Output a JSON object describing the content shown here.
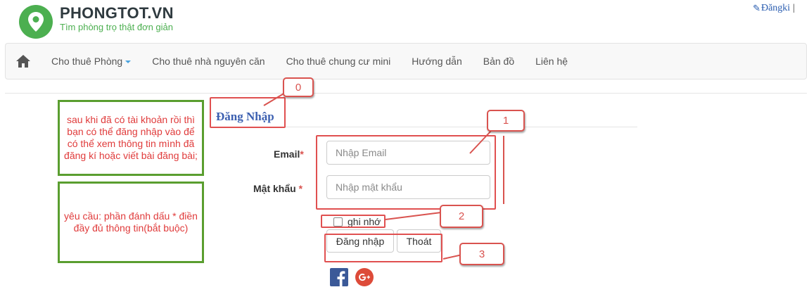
{
  "header": {
    "logo_name": "PHONGTOT.VN",
    "logo_slogan": "Tìm phòng trọ thật đơn giản",
    "register_label": "Đăngki",
    "register_separator": "|"
  },
  "nav": {
    "items": [
      {
        "label": "Cho thuê Phòng",
        "has_caret": true
      },
      {
        "label": "Cho thuê nhà nguyên căn"
      },
      {
        "label": "Cho thuê chung cư mini"
      },
      {
        "label": "Hướng dẫn"
      },
      {
        "label": "Bản đồ"
      },
      {
        "label": "Liên hệ"
      }
    ]
  },
  "form": {
    "title": "Đăng Nhập",
    "email_label": "Email",
    "email_placeholder": "Nhập Email",
    "password_label": "Mật khẩu",
    "password_placeholder": "Nhập mật khẩu",
    "required_mark": "*",
    "remember_label": "ghi nhớ",
    "login_button": "Đăng nhập",
    "exit_button": "Thoát"
  },
  "annotations": {
    "note_1": "sau khi đã có tài khoản rồi thì bạn có thể đăng nhập vào để có thể xem thông tin mình đã đăng kí hoặc viết bài đăng bài;",
    "note_2": "yêu cầu: phần đánh dấu * điền đầy đủ thông tin(bắt buộc)",
    "callouts": [
      "0",
      "1",
      "2",
      "3"
    ]
  },
  "colors": {
    "brand_green": "#4caf50",
    "link_blue": "#2a5db0",
    "annotation_red": "#d9534f",
    "note_border_green": "#5a9e2f"
  },
  "icons": [
    "map-pin-logo",
    "pencil-icon",
    "home-icon",
    "facebook-icon",
    "google-plus-icon"
  ]
}
